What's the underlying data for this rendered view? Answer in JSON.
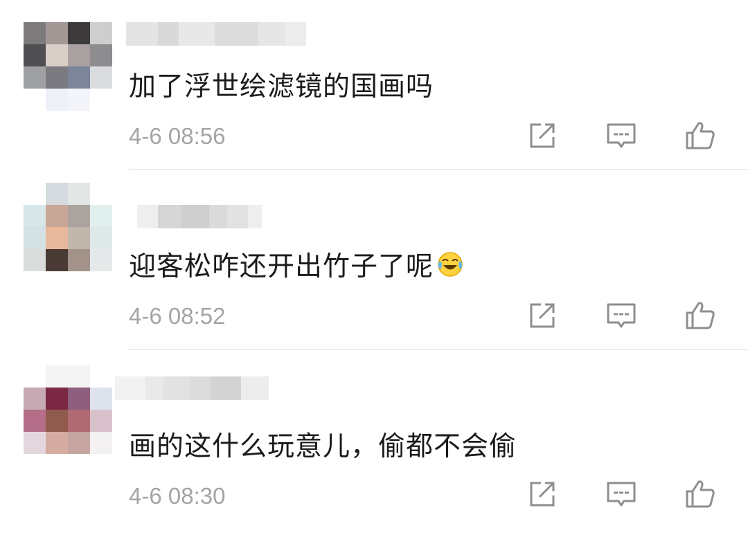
{
  "comments": [
    {
      "text": "加了浮世绘滤镜的国画吗",
      "time": "4-6 08:56",
      "avatar_pixels": [
        [
          "#7e7b7c",
          "#a29896",
          "#3d3a3b",
          "#cfcecf"
        ],
        [
          "#4f4e50",
          "#d9cdc7",
          "#a9a0a1",
          "#8d8c8e"
        ],
        [
          "#9fa0a2",
          "#7a7a80",
          "#7d859b",
          "#dadcdf"
        ],
        [
          "#ffffff",
          "#eef1f8",
          "#f3f5fa",
          "#ffffff"
        ]
      ],
      "name_blur": [
        "#e4e4e4",
        "#d9d9d9",
        "#e8e8e8",
        "#dcdcdc",
        "#e6e6e6",
        "#ececec"
      ],
      "has_emoji": false
    },
    {
      "text": "迎客松咋还开出竹子了呢",
      "time": "4-6 08:52",
      "avatar_pixels": [
        [
          "#ffffff",
          "#d5dbde",
          "#e2e7e6",
          "#ffffff"
        ],
        [
          "#d7e7e8",
          "#c9a796",
          "#aba49e",
          "#e2efef"
        ],
        [
          "#d3e1e4",
          "#e8b89c",
          "#c2b7ad",
          "#dfe9ea"
        ],
        [
          "#d9dcdb",
          "#4a3a35",
          "#a2928a",
          "#e6e9ea"
        ]
      ],
      "name_blur": [
        "#eeeeee",
        "#d6d6d6",
        "#cfcfcf",
        "#dadada",
        "#e2e2e2",
        "#efefef"
      ],
      "has_emoji": true
    },
    {
      "text": "画的这什么玩意儿，偷都不会偷",
      "time": "4-6 08:30",
      "avatar_pixels": [
        [
          "#ffffff",
          "#f4f4f4",
          "#f4f4f4",
          "#ffffff"
        ],
        [
          "#c6a9b2",
          "#7a2843",
          "#8e5e7f",
          "#dde2ec"
        ],
        [
          "#b46e87",
          "#915a4e",
          "#b06a73",
          "#d9c1cb"
        ],
        [
          "#e3d7dd",
          "#d5aca1",
          "#c7a5a3",
          "#f3f1f2"
        ]
      ],
      "name_blur": [
        "#f2f2f2",
        "#e9e9e9",
        "#e2e2e2",
        "#dcdcdc",
        "#d3d3d3",
        "#ededed"
      ],
      "has_emoji": false
    }
  ],
  "actions": {
    "repost_icon": "repost-icon",
    "comment_icon": "comment-icon",
    "like_icon": "thumbs-up-icon"
  },
  "colors": {
    "text": "#1b1b1b",
    "timestamp": "#a4a4a4",
    "icon": "#8e8e8e",
    "divider": "#ececec"
  }
}
